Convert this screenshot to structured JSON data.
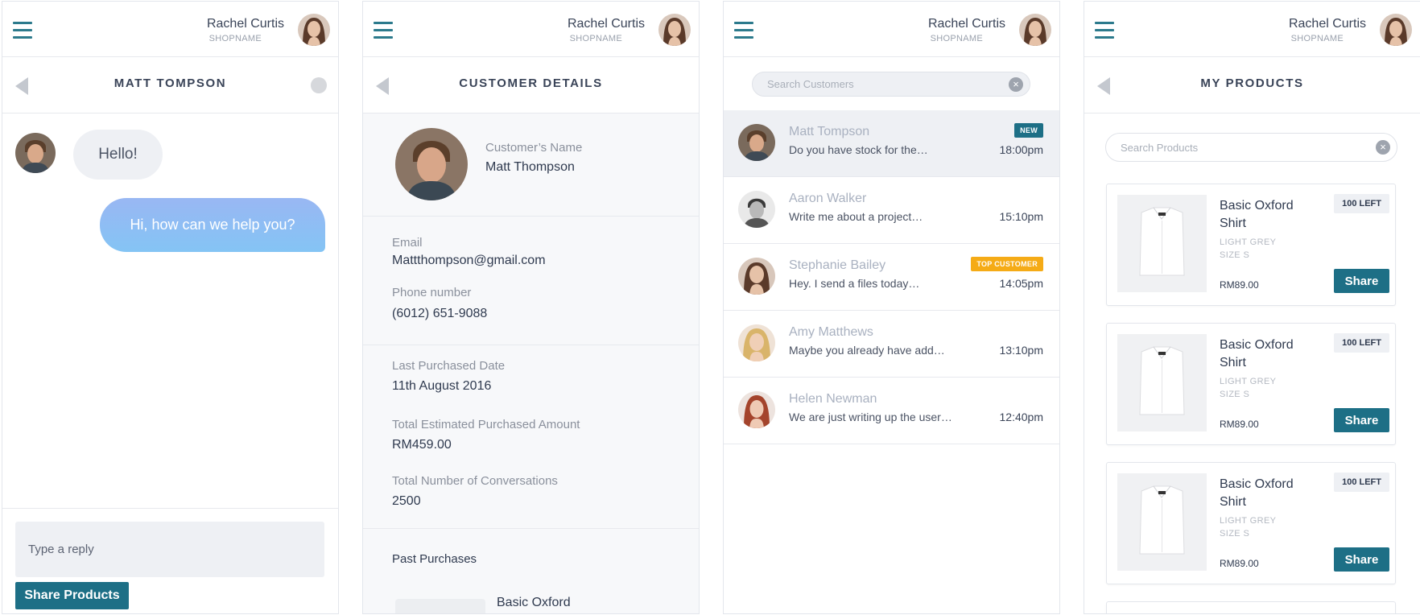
{
  "top_bar": {
    "user_name": "Rachel Curtis",
    "shop_name": "SHOPNAME"
  },
  "chat": {
    "title": "MATT TOMPSON",
    "incoming_message": "Hello!",
    "outgoing_message": "Hi, how can we help you?",
    "reply_placeholder": "Type a reply",
    "share_products_label": "Share Products"
  },
  "customer_details": {
    "title": "CUSTOMER DETAILS",
    "name_label": "Customer’s Name",
    "name_value": "Matt Thompson",
    "email_label": "Email",
    "email_value": "Mattthompson@gmail.com",
    "phone_label": "Phone number",
    "phone_value": "(6012) 651-9088",
    "last_purchased_label": "Last Purchased Date",
    "last_purchased_value": "11th August 2016",
    "total_amount_label": "Total Estimated Purchased Amount",
    "total_amount_value": "RM459.00",
    "conversations_label": "Total Number of Conversations",
    "conversations_value": "2500",
    "past_purchases_label": "Past Purchases",
    "past_purchase_item": "Basic Oxford"
  },
  "customer_list": {
    "search_placeholder": "Search Customers",
    "customers": [
      {
        "name": "Matt Tompson",
        "message": "Do you have stock for the…",
        "time": "18:00pm",
        "badge": "NEW"
      },
      {
        "name": "Aaron Walker",
        "message": "Write me about a project…",
        "time": "15:10pm",
        "badge": ""
      },
      {
        "name": "Stephanie Bailey",
        "message": "Hey. I send a files today…",
        "time": "14:05pm",
        "badge": "TOP CUSTOMER"
      },
      {
        "name": "Amy Matthews",
        "message": "Maybe you already have add…",
        "time": "13:10pm",
        "badge": ""
      },
      {
        "name": "Helen Newman",
        "message": "We are just writing up the user…",
        "time": "12:40pm",
        "badge": ""
      }
    ]
  },
  "products": {
    "title": "MY PRODUCTS",
    "search_placeholder": "Search Products",
    "items": [
      {
        "name": "Basic Oxford Shirt",
        "stock": "100 LEFT",
        "color": "LIGHT GREY",
        "size": "SIZE S",
        "price": "RM89.00",
        "share_label": "Share"
      },
      {
        "name": "Basic Oxford Shirt",
        "stock": "100 LEFT",
        "color": "LIGHT GREY",
        "size": "SIZE S",
        "price": "RM89.00",
        "share_label": "Share"
      },
      {
        "name": "Basic Oxford Shirt",
        "stock": "100 LEFT",
        "color": "LIGHT GREY",
        "size": "SIZE S",
        "price": "RM89.00",
        "share_label": "Share"
      }
    ]
  },
  "colors": {
    "accent": "#1d6f86",
    "badge_new": "#1d6f86",
    "badge_top_customer": "#f5ab16",
    "bubble_gradient_top": "#99b7f3",
    "bubble_gradient_bottom": "#84c4f4"
  },
  "icons": [
    "hamburger-menu-icon",
    "back-arrow-icon",
    "status-dot-icon",
    "clear-search-icon",
    "avatar-icon",
    "shirt-product-image"
  ]
}
